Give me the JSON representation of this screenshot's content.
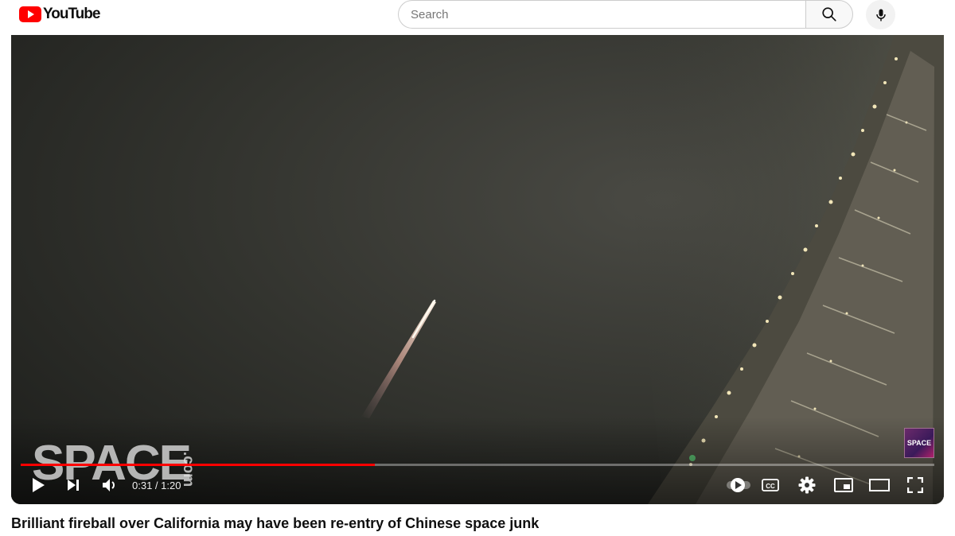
{
  "header": {
    "logo_text": "YouTube",
    "search": {
      "placeholder": "Search",
      "value": ""
    },
    "icons": {
      "search": "search-icon",
      "mic": "mic-icon"
    }
  },
  "player": {
    "watermark": "SPACE",
    "watermark_sub": ".com",
    "channel_badge": "SPACE",
    "current_time": "0:31",
    "separator": " / ",
    "duration": "1:20",
    "progress_fraction": 0.3875,
    "controls": [
      "play-icon",
      "next-icon",
      "volume-icon",
      "autoplay-toggle",
      "cc-icon",
      "settings-icon",
      "miniplayer-icon",
      "theater-icon",
      "fullscreen-icon"
    ]
  },
  "video": {
    "title": "Brilliant fireball over California may have been re-entry of Chinese space junk"
  },
  "colors": {
    "brand_red": "#ff0000",
    "progress_red": "#ff0000",
    "title_text": "#0f0f0f"
  }
}
